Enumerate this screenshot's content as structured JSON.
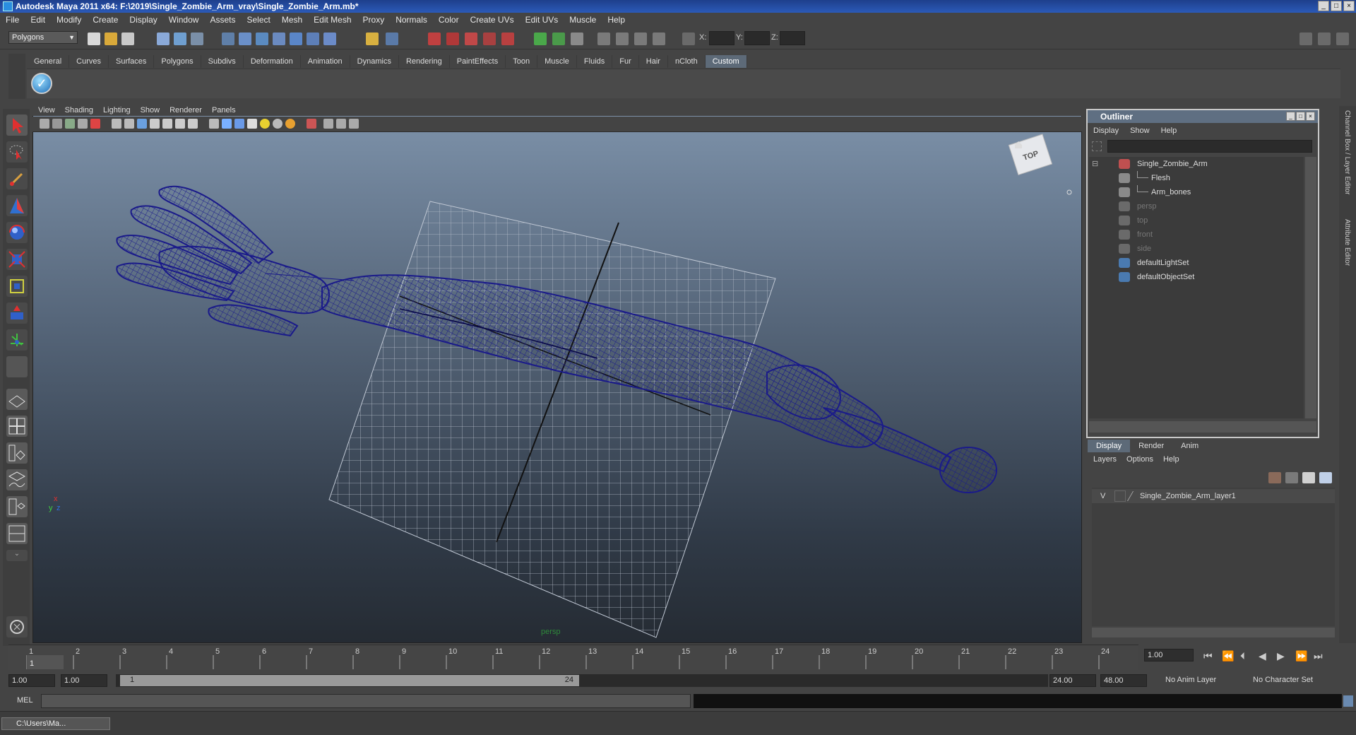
{
  "window": {
    "title": "Autodesk Maya 2011 x64: F:\\2019\\Single_Zombie_Arm_vray\\Single_Zombie_Arm.mb*"
  },
  "menubar": [
    "File",
    "Edit",
    "Modify",
    "Create",
    "Display",
    "Window",
    "Assets",
    "Select",
    "Mesh",
    "Edit Mesh",
    "Proxy",
    "Normals",
    "Color",
    "Create UVs",
    "Edit UVs",
    "Muscle",
    "Help"
  ],
  "toolbar": {
    "mode": "Polygons",
    "coord_labels": [
      "X:",
      "Y:",
      "Z:"
    ]
  },
  "shelf": {
    "tabs": [
      "General",
      "Curves",
      "Surfaces",
      "Polygons",
      "Subdivs",
      "Deformation",
      "Animation",
      "Dynamics",
      "Rendering",
      "PaintEffects",
      "Toon",
      "Muscle",
      "Fluids",
      "Fur",
      "Hair",
      "nCloth",
      "Custom"
    ],
    "active_tab": "Custom"
  },
  "viewport": {
    "menu": [
      "View",
      "Shading",
      "Lighting",
      "Show",
      "Renderer",
      "Panels"
    ],
    "camera_label": "persp",
    "viewcube_label": "TOP",
    "axis_labels": {
      "x": "x",
      "y": "y",
      "z": "z"
    },
    "wire_color": "#1a1a8a"
  },
  "outliner": {
    "title": "Outliner",
    "menu": [
      "Display",
      "Show",
      "Help"
    ],
    "items": [
      {
        "label": "Single_Zombie_Arm",
        "indent": 0,
        "dim": false,
        "icon": "transform-icon"
      },
      {
        "label": "Flesh",
        "indent": 1,
        "dim": false,
        "icon": "mesh-icon"
      },
      {
        "label": "Arm_bones",
        "indent": 1,
        "dim": false,
        "icon": "mesh-icon"
      },
      {
        "label": "persp",
        "indent": 0,
        "dim": true,
        "icon": "camera-icon"
      },
      {
        "label": "top",
        "indent": 0,
        "dim": true,
        "icon": "camera-icon"
      },
      {
        "label": "front",
        "indent": 0,
        "dim": true,
        "icon": "camera-icon"
      },
      {
        "label": "side",
        "indent": 0,
        "dim": true,
        "icon": "camera-icon"
      },
      {
        "label": "defaultLightSet",
        "indent": 0,
        "dim": false,
        "icon": "set-icon"
      },
      {
        "label": "defaultObjectSet",
        "indent": 0,
        "dim": false,
        "icon": "set-icon"
      }
    ]
  },
  "layer_editor": {
    "tabs": [
      "Display",
      "Render",
      "Anim"
    ],
    "active_tab": "Display",
    "menu": [
      "Layers",
      "Options",
      "Help"
    ],
    "layers": [
      {
        "visible": "V",
        "name": "Single_Zombie_Arm_layer1"
      }
    ]
  },
  "right_strip": {
    "labels": [
      "Channel Box / Layer Editor",
      "Attribute Editor"
    ]
  },
  "timeline": {
    "ticks": [
      "1",
      "2",
      "3",
      "4",
      "5",
      "6",
      "7",
      "8",
      "9",
      "10",
      "11",
      "12",
      "13",
      "14",
      "15",
      "16",
      "17",
      "18",
      "19",
      "20",
      "21",
      "22",
      "23",
      "24"
    ],
    "current_frame": "1",
    "current_time_field": "1.00"
  },
  "range": {
    "start_time": "1.00",
    "playback_start": "1.00",
    "slider_start": "1",
    "slider_end": "24",
    "playback_end": "24.00",
    "end_time": "48.00",
    "anim_layer": "No Anim Layer",
    "character_set": "No Character Set"
  },
  "command": {
    "language": "MEL"
  },
  "taskbar": {
    "label": "C:\\Users\\Ma..."
  }
}
